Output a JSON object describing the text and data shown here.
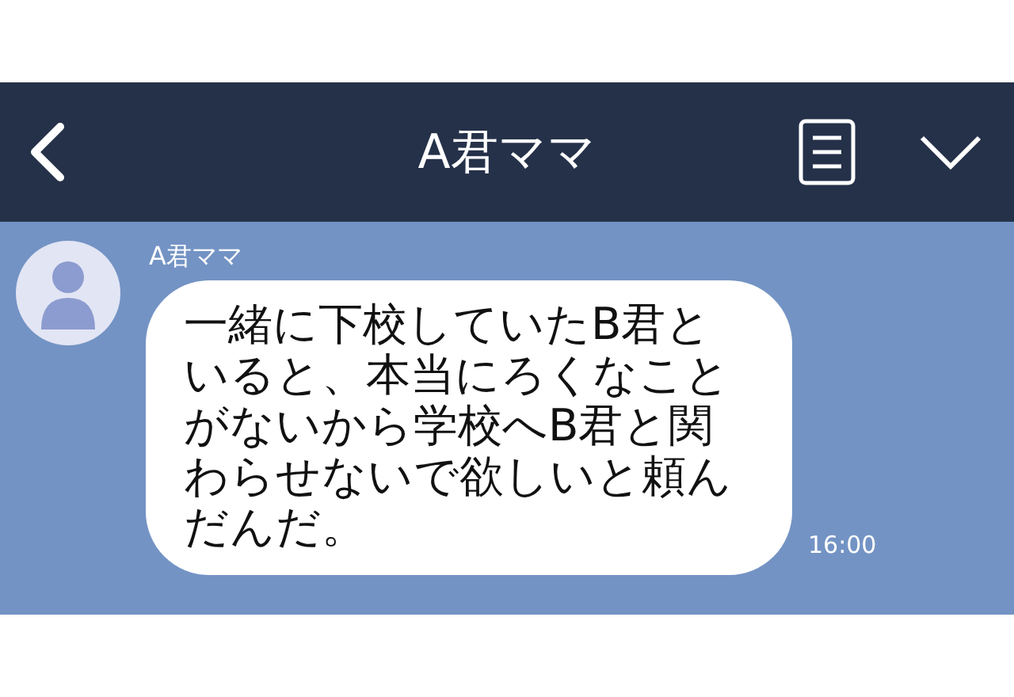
{
  "header": {
    "title": "A君ママ"
  },
  "messages": [
    {
      "sender": "A君ママ",
      "text": "一緒に下校していたB君といると、本当にろくなことがないから学校へB君と関わらせないで欲しいと頼んだんだ。",
      "time": "16:00"
    }
  ]
}
